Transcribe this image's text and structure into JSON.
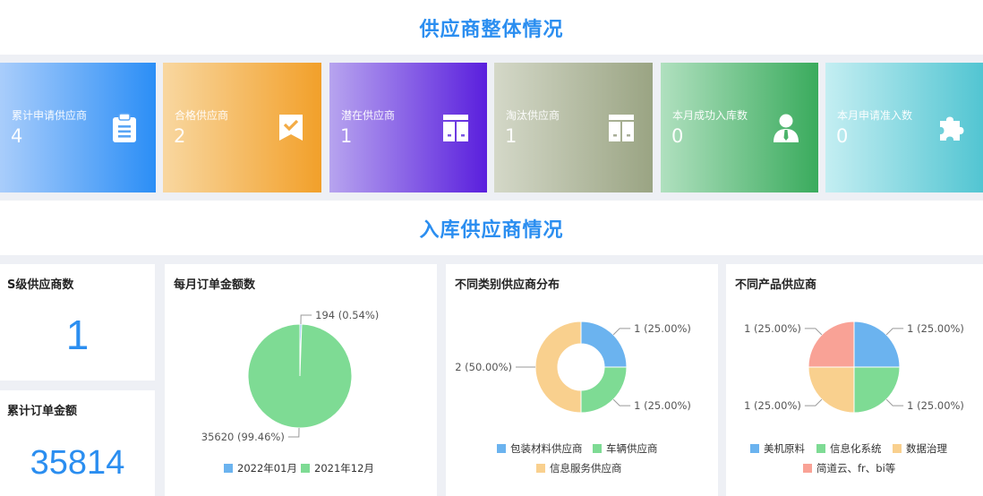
{
  "header": {
    "title": "供应商整体情况"
  },
  "section2": {
    "title": "入库供应商情况"
  },
  "cards": [
    {
      "label": "累计申请供应商",
      "value": "4",
      "icon": "clipboard-icon",
      "c1": "#a9cdfb",
      "c2": "#2b8ef6"
    },
    {
      "label": "合格供应商",
      "value": "2",
      "icon": "badge-check-icon",
      "c1": "#f8d7a0",
      "c2": "#f2a02a"
    },
    {
      "label": "潜在供应商",
      "value": "1",
      "icon": "kanban-icon",
      "c1": "#b7a4ef",
      "c2": "#5a1fdd"
    },
    {
      "label": "淘汰供应商",
      "value": "1",
      "icon": "kanban-icon",
      "c1": "#d4d8c8",
      "c2": "#9aa483"
    },
    {
      "label": "本月成功入库数",
      "value": "0",
      "icon": "user-icon",
      "c1": "#b0e0bf",
      "c2": "#3aab5d"
    },
    {
      "label": "本月申请准入数",
      "value": "0",
      "icon": "puzzle-icon",
      "c1": "#c4eef2",
      "c2": "#52c5d2"
    }
  ],
  "s_level": {
    "title": "S级供应商数",
    "value": "1"
  },
  "total_amount": {
    "title": "累计订单金额",
    "value": "35814"
  },
  "chart_data": [
    {
      "type": "pie",
      "title": "每月订单金额数",
      "categories": [
        "2022年01月",
        "2021年12月"
      ],
      "values": [
        194,
        35620
      ],
      "labels": [
        "194 (0.54%)",
        "35620 (99.46%)"
      ],
      "colors": [
        "#6bb3ef",
        "#7edb94"
      ],
      "legend": "bottom"
    },
    {
      "type": "pie",
      "variant": "donut",
      "title": "不同类别供应商分布",
      "categories": [
        "包装材料供应商",
        "车辆供应商",
        "信息服务供应商"
      ],
      "values": [
        1,
        1,
        2
      ],
      "labels": [
        "1 (25.00%)",
        "1 (25.00%)",
        "2 (50.00%)"
      ],
      "colors": [
        "#6bb3ef",
        "#7edb94",
        "#f9d08e"
      ],
      "legend": "bottom"
    },
    {
      "type": "pie",
      "title": "不同产品供应商",
      "categories": [
        "美机原料",
        "信息化系统",
        "数据治理",
        "简道云、fr、bi等"
      ],
      "values": [
        1,
        1,
        1,
        1
      ],
      "labels": [
        "1 (25.00%)",
        "1 (25.00%)",
        "1 (25.00%)",
        "1 (25.00%)"
      ],
      "colors": [
        "#6bb3ef",
        "#7edb94",
        "#f9d08e",
        "#f9a296"
      ],
      "legend": "bottom"
    }
  ]
}
